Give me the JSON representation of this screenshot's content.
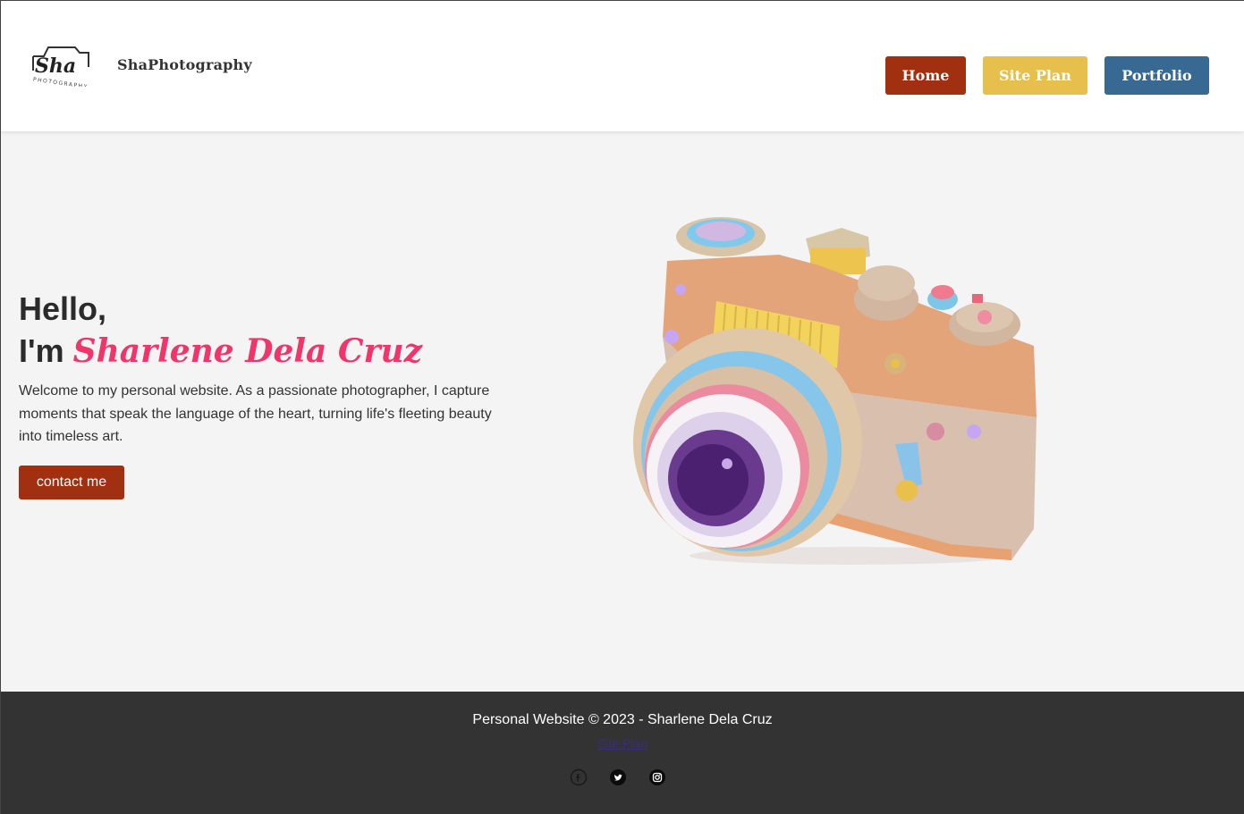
{
  "header": {
    "logo_text": "Sha",
    "logo_subtext": "PHOTOGRAPHY",
    "brand": "ShaPhotography",
    "nav": [
      {
        "label": "Home",
        "color": "#a0300f"
      },
      {
        "label": "Site Plan",
        "color": "#e6bf4d"
      },
      {
        "label": "Portfolio",
        "color": "#386992"
      }
    ]
  },
  "hero": {
    "greeting": "Hello,",
    "im": "I'm ",
    "name": "Sharlene Dela Cruz",
    "name_color": "#f0356a",
    "intro": "Welcome to my personal website. As a passionate photographer, I capture moments that speak the language of the heart, turning life's fleeting beauty into timeless art.",
    "cta": "contact me",
    "image_icon": "camera-illustration"
  },
  "footer": {
    "copyright": "Personal Website © 2023 - Sharlene Dela Cruz",
    "link": "Site Plan",
    "social": [
      "facebook-icon",
      "twitter-icon",
      "instagram-icon"
    ]
  }
}
